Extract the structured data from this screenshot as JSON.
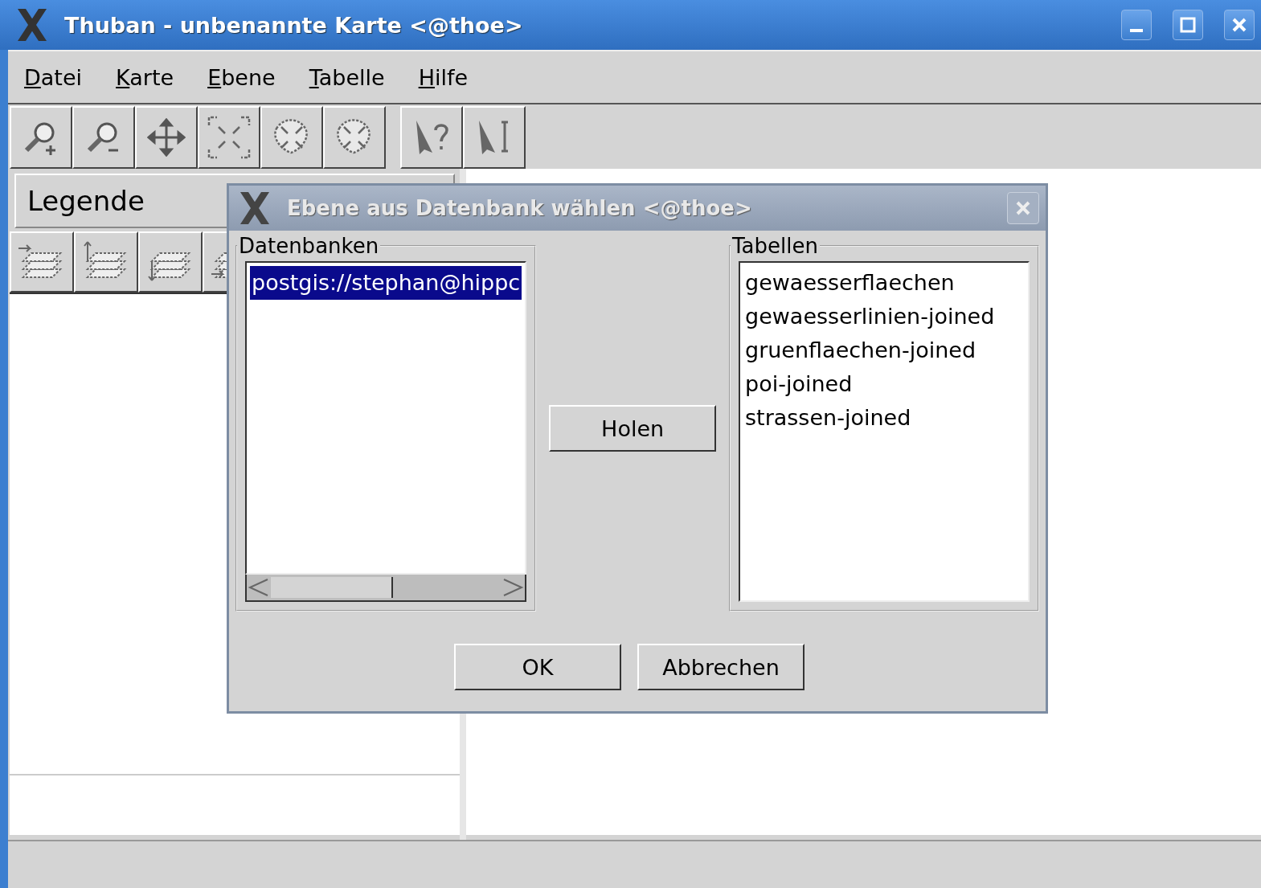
{
  "window": {
    "title": "Thuban - unbenannte Karte <@thoe>"
  },
  "menu": [
    {
      "label": "Datei"
    },
    {
      "label": "Karte"
    },
    {
      "label": "Ebene"
    },
    {
      "label": "Tabelle"
    },
    {
      "label": "Hilfe"
    }
  ],
  "legend": {
    "title": "Legende"
  },
  "dialog": {
    "title": "Ebene aus Datenbank wählen <@thoe>",
    "databases": {
      "label": "Datenbanken",
      "items": [
        {
          "label": "postgis://stephan@hippc",
          "selected": true
        }
      ]
    },
    "fetch_button": "Holen",
    "tables": {
      "label": "Tabellen",
      "items": [
        {
          "label": "gewaesserflaechen",
          "selected": false
        },
        {
          "label": "gewaesserlinien-joined",
          "selected": false
        },
        {
          "label": "gruenflaechen-joined",
          "selected": false
        },
        {
          "label": "poi-joined",
          "selected": false
        },
        {
          "label": "strassen-joined",
          "selected": false
        }
      ]
    },
    "buttons": [
      "OK",
      "Abbrechen"
    ]
  }
}
